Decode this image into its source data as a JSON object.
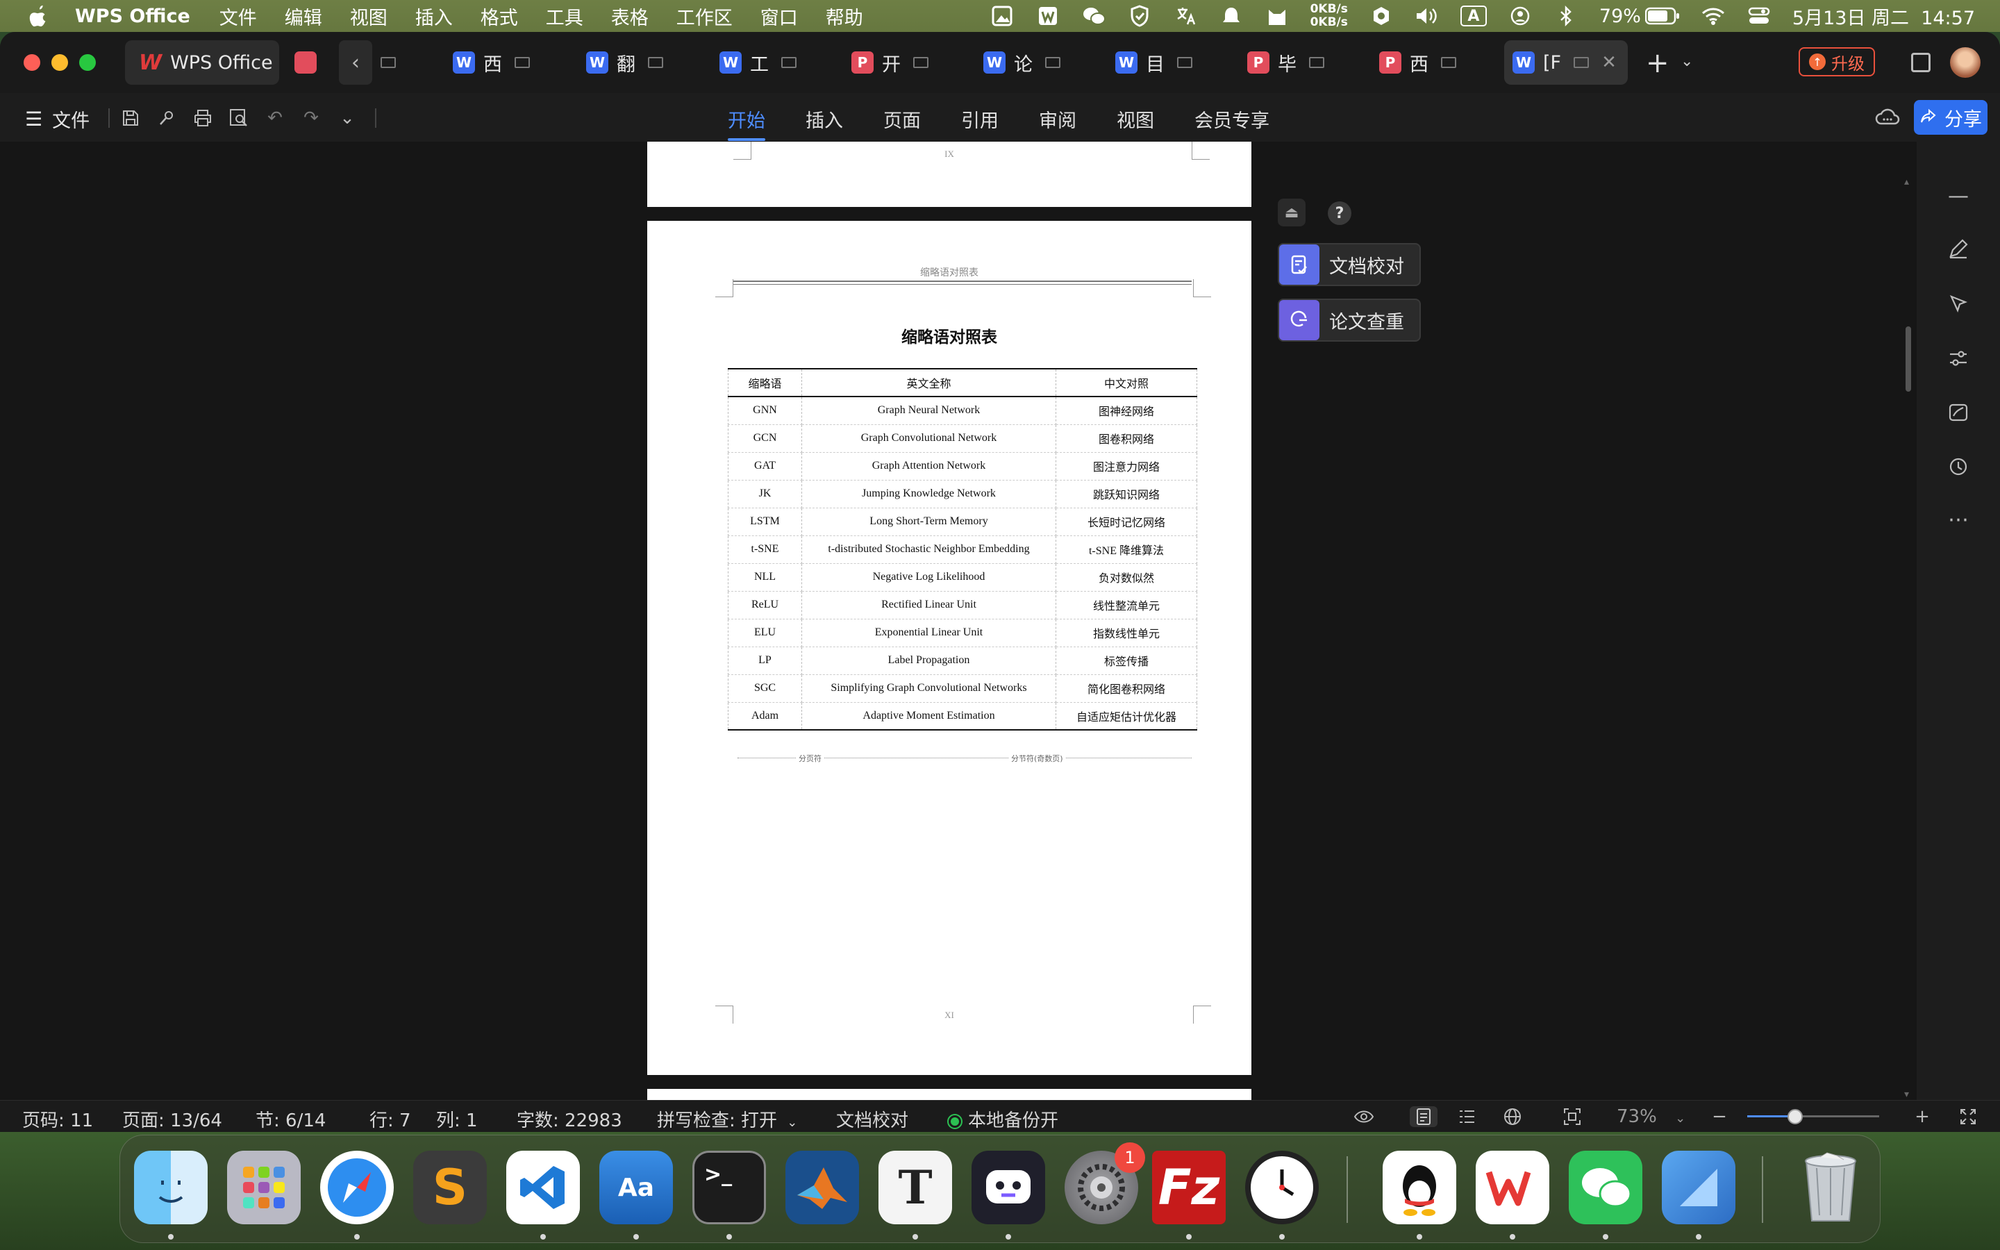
{
  "menubar": {
    "app_name": "WPS Office",
    "menus": [
      "文件",
      "编辑",
      "视图",
      "插入",
      "格式",
      "工具",
      "表格",
      "工作区",
      "窗口",
      "帮助"
    ],
    "net_up": "0KB/s",
    "net_down": "0KB/s",
    "input_method": "A",
    "battery": "79%",
    "datetime": "5月13日 周二  14:57"
  },
  "tabs": {
    "home_label": "WPS Office",
    "docs": [
      {
        "kind": "W",
        "title": "西"
      },
      {
        "kind": "W",
        "title": "翻"
      },
      {
        "kind": "W",
        "title": "工"
      },
      {
        "kind": "P",
        "title": "开"
      },
      {
        "kind": "W",
        "title": "论"
      },
      {
        "kind": "W",
        "title": "目"
      },
      {
        "kind": "P",
        "title": "毕"
      },
      {
        "kind": "P",
        "title": "西"
      },
      {
        "kind": "W",
        "title": "[F"
      }
    ],
    "upgrade_label": "升级"
  },
  "toolbar": {
    "file_label": "文件",
    "ribbon_tabs": [
      "开始",
      "插入",
      "页面",
      "引用",
      "审阅",
      "视图",
      "会员专享"
    ],
    "active_tab": "开始",
    "share_label": "分享"
  },
  "document": {
    "prev_page_number": "IX",
    "header_text": "缩略语对照表",
    "title": "缩略语对照表",
    "table": {
      "headers": [
        "缩略语",
        "英文全称",
        "中文对照"
      ],
      "rows": [
        [
          "GNN",
          "Graph Neural Network",
          "图神经网络"
        ],
        [
          "GCN",
          "Graph Convolutional Network",
          "图卷积网络"
        ],
        [
          "GAT",
          "Graph Attention Network",
          "图注意力网络"
        ],
        [
          "JK",
          "Jumping Knowledge Network",
          "跳跃知识网络"
        ],
        [
          "LSTM",
          "Long Short-Term Memory",
          "长短时记忆网络"
        ],
        [
          "t-SNE",
          "t-distributed Stochastic Neighbor Embedding",
          "t-SNE 降维算法"
        ],
        [
          "NLL",
          "Negative Log Likelihood",
          "负对数似然"
        ],
        [
          "ReLU",
          "Rectified Linear Unit",
          "线性整流单元"
        ],
        [
          "ELU",
          "Exponential Linear Unit",
          "指数线性单元"
        ],
        [
          "LP",
          "Label Propagation",
          "标签传播"
        ],
        [
          "SGC",
          "Simplifying Graph Convolutional Networks",
          "简化图卷积网络"
        ],
        [
          "Adam",
          "Adaptive Moment Estimation",
          "自适应矩估计优化器"
        ]
      ]
    },
    "page_break_label": "分页符",
    "section_break_label": "分节符(奇数页)",
    "footer_page_number": "XI"
  },
  "float_panel": {
    "help_label": "?",
    "proofread_label": "文档校对",
    "plagiarism_label": "论文查重"
  },
  "statusbar": {
    "page_code": "页码: 11",
    "page": "页面: 13/64",
    "section": "节: 6/14",
    "row": "行: 7",
    "col": "列: 1",
    "word_count": "字数: 22983",
    "spellcheck": "拼写检查: 打开",
    "proofread": "文档校对",
    "backup": "本地备份开",
    "zoom": "73%",
    "zoom_level": 0.73
  },
  "dock": {
    "settings_badge": "1"
  },
  "colors": {
    "accent": "#4e8dff",
    "wps_red": "#e03b3b",
    "word_blue": "#3b6bf0",
    "ppt_red": "#e24d5c",
    "share_blue": "#2f6fef",
    "backup_green": "#2cc152"
  }
}
